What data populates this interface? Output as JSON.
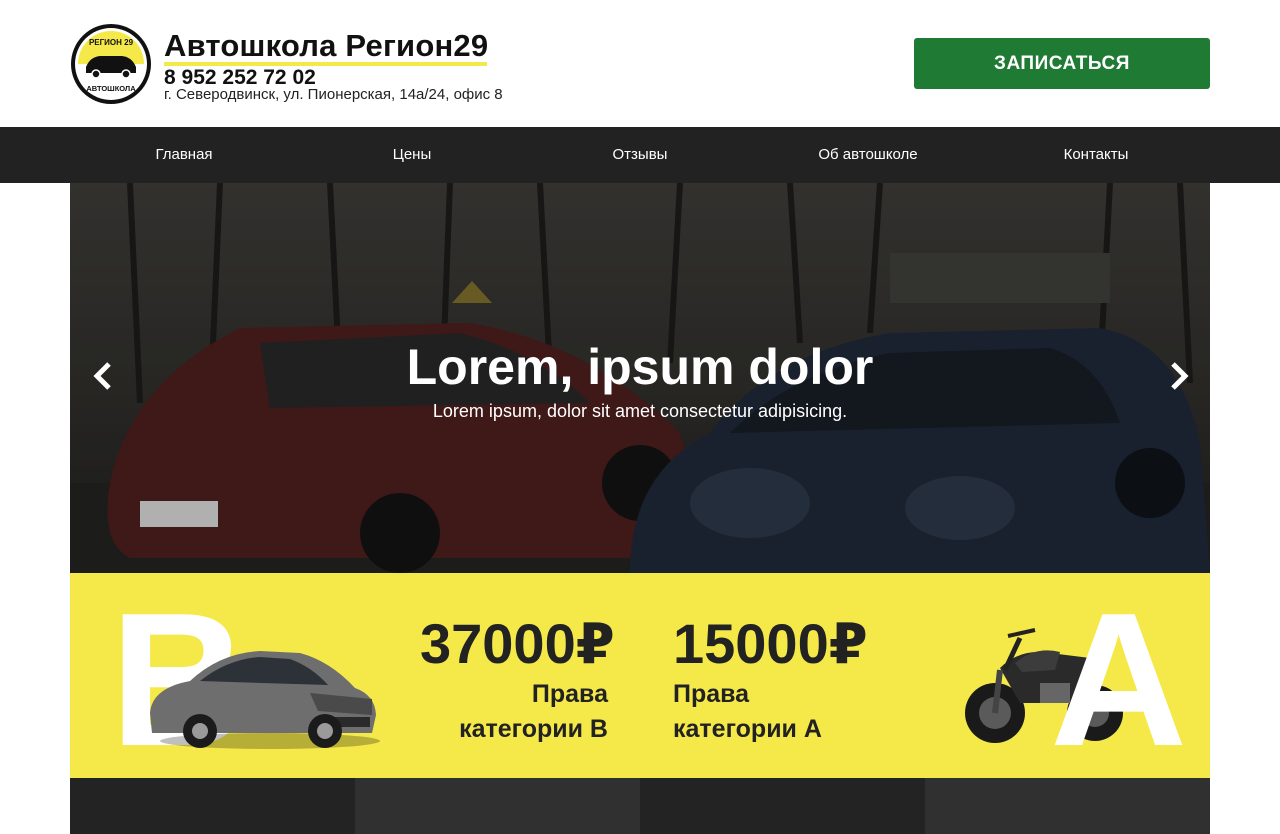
{
  "header": {
    "logo_text_top": "РЕГИОН 29",
    "logo_text_bottom": "АВТОШКОЛА",
    "brand_name": "Автошкола Регион29",
    "phone": "8 952 252 72 02",
    "address": "г. Северодвинск, ул. Пионерская, 14а/24, офис 8",
    "signup_label": "ЗАПИСАТЬСЯ"
  },
  "nav": {
    "items": [
      {
        "label": "Главная"
      },
      {
        "label": "Цены"
      },
      {
        "label": "Отзывы"
      },
      {
        "label": "Об автошколе"
      },
      {
        "label": "Контакты"
      }
    ]
  },
  "hero": {
    "title": "Lorem, ipsum dolor",
    "subtitle": "Lorem ipsum, dolor sit amet consectetur adipisicing.",
    "prev_icon": "chevron-left-icon",
    "next_icon": "chevron-right-icon"
  },
  "pricing": {
    "category_b": {
      "letter": "B",
      "price": "37000₽",
      "label_line1": "Права",
      "label_line2": "категории B"
    },
    "category_a": {
      "letter": "A",
      "price": "15000₽",
      "label_line1": "Права",
      "label_line2": "категории A"
    }
  },
  "colors": {
    "accent_yellow": "#f5e94a",
    "button_green": "#1f7a34",
    "nav_dark": "#222222",
    "text_dark": "#222222"
  }
}
